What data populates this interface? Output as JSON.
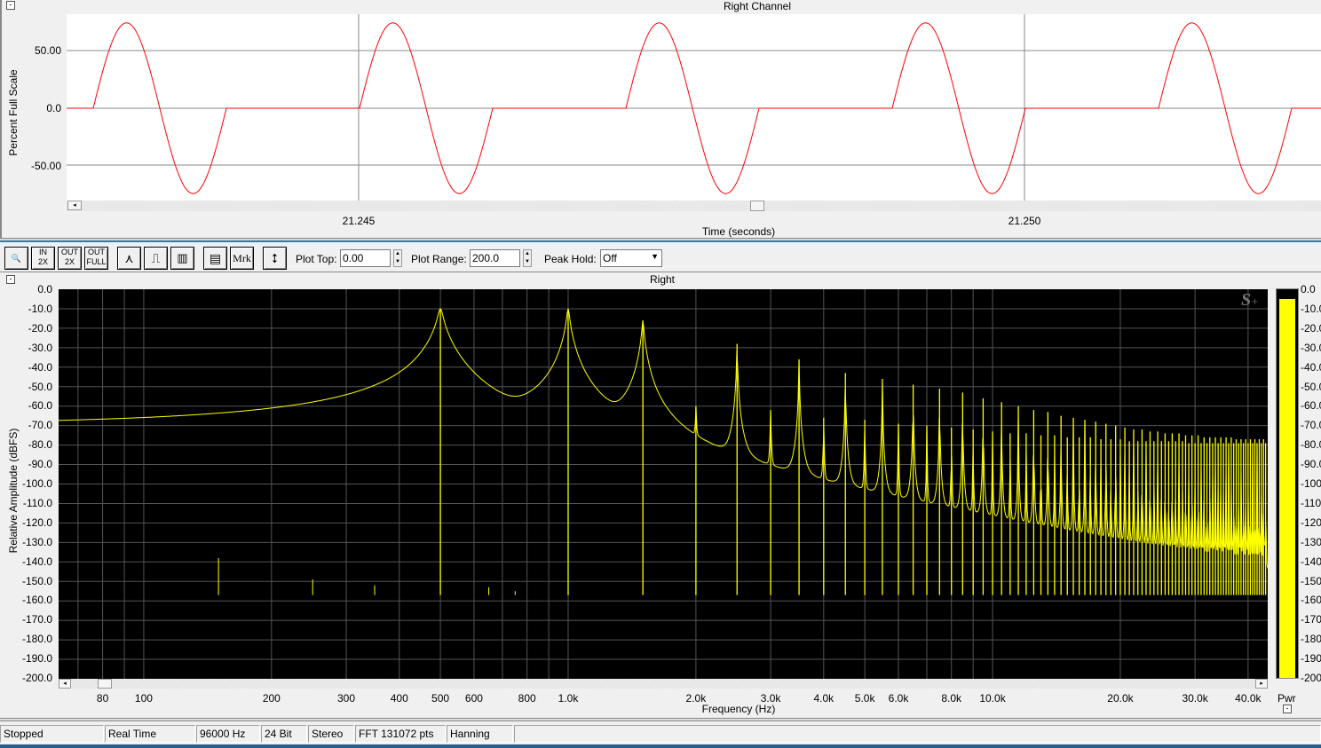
{
  "top_panel": {
    "title": "Right Channel",
    "ylabel": "Percent Full Scale",
    "xlabel": "Time (seconds)",
    "yticks": [
      "50.00",
      "0.0",
      "-50.00"
    ],
    "xticks": [
      "21.245",
      "21.250"
    ],
    "trace_color": "#ff0000"
  },
  "toolbar": {
    "plot_top_label": "Plot Top:",
    "plot_top_value": "0.00",
    "plot_range_label": "Plot Range:",
    "plot_range_value": "200.0",
    "peak_hold_label": "Peak Hold:",
    "peak_hold_value": "Off",
    "buttons": [
      "zoom-in",
      "in 2X",
      "out 2X",
      "out full",
      "line-mode",
      "step-mode",
      "bar-mode",
      "settings",
      "Mrk",
      "scale"
    ],
    "mrk_label": "Mrk"
  },
  "spectrum": {
    "title": "Right",
    "ylabel": "Relative Amplitude (dBFS)",
    "xlabel": "Frequency (Hz)",
    "logo": "S+",
    "meter_label": "Pwr",
    "yticks": [
      "0.0",
      "-10.0",
      "-20.0",
      "-30.0",
      "-40.0",
      "-50.0",
      "-60.0",
      "-70.0",
      "-80.0",
      "-90.0",
      "-100.0",
      "-110.0",
      "-120.0",
      "-130.0",
      "-140.0",
      "-150.0",
      "-160.0",
      "-170.0",
      "-180.0",
      "-190.0",
      "-200.0"
    ],
    "xticks": [
      {
        "f": 80,
        "label": "80"
      },
      {
        "f": 100,
        "label": "100"
      },
      {
        "f": 200,
        "label": "200"
      },
      {
        "f": 300,
        "label": "300"
      },
      {
        "f": 400,
        "label": "400"
      },
      {
        "f": 500,
        "label": "500"
      },
      {
        "f": 600,
        "label": "600"
      },
      {
        "f": 800,
        "label": "800"
      },
      {
        "f": 1000,
        "label": "1.0k"
      },
      {
        "f": 2000,
        "label": "2.0k"
      },
      {
        "f": 3000,
        "label": "3.0k"
      },
      {
        "f": 4000,
        "label": "4.0k"
      },
      {
        "f": 5000,
        "label": "5.0k"
      },
      {
        "f": 6000,
        "label": "6.0k"
      },
      {
        "f": 8000,
        "label": "8.0k"
      },
      {
        "f": 10000,
        "label": "10.0k"
      },
      {
        "f": 20000,
        "label": "20.0k"
      },
      {
        "f": 30000,
        "label": "30.0k"
      },
      {
        "f": 40000,
        "label": "40.0k"
      }
    ],
    "trace_color": "#ffff00",
    "meter_level_db": -5
  },
  "chart_data": {
    "type": "line",
    "title": "Right",
    "xlabel": "Frequency (Hz)",
    "ylabel": "Relative Amplitude (dBFS)",
    "xscale": "log",
    "xlim": [
      63,
      44500
    ],
    "ylim": [
      -200,
      0
    ],
    "grid": true,
    "noise_floor_db": -157,
    "spurs": [
      {
        "f": 150,
        "db": -138
      },
      {
        "f": 250,
        "db": -149
      },
      {
        "f": 350,
        "db": -152
      },
      {
        "f": 650,
        "db": -153
      },
      {
        "f": 750,
        "db": -155
      }
    ],
    "harmonic_spacing_hz": 500,
    "harmonic_peaks_db": [
      -10,
      -10,
      -16,
      -60,
      -28,
      -62,
      -36,
      -66,
      -43,
      -67,
      -46,
      -69,
      -49,
      -70,
      -51,
      -71,
      -53,
      -72,
      -56,
      -73,
      -58,
      -74,
      -60,
      -74,
      -62,
      -75,
      -63,
      -75,
      -65,
      -76,
      -66,
      -76,
      -67,
      -76,
      -68,
      -77,
      -69,
      -77,
      -70,
      -77,
      -71,
      -78,
      -72,
      -78,
      -72,
      -78,
      -73,
      -78,
      -73,
      -78,
      -74,
      -78,
      -74,
      -78,
      -74,
      -78,
      -75,
      -79,
      -75,
      -79,
      -75,
      -79,
      -76,
      -79,
      -76,
      -79,
      -76,
      -79,
      -76,
      -79,
      -76,
      -79,
      -76,
      -79,
      -77,
      -79,
      -77,
      -79,
      -77,
      -79,
      -77,
      -79,
      -77,
      -79,
      -77,
      -79,
      -77,
      -79
    ]
  },
  "status_bar": [
    "Stopped",
    "Real Time",
    "96000 Hz",
    "24 Bit",
    "Stereo",
    "FFT 131072 pts",
    "Hanning",
    ""
  ]
}
